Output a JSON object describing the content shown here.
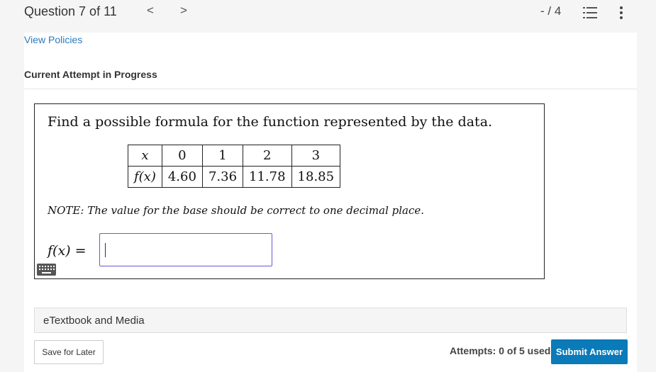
{
  "header": {
    "question_label": "Question 7 of 11",
    "prev_glyph": "<",
    "next_glyph": ">",
    "score": "- / 4",
    "list_icon": "question-list-icon",
    "more_icon": "more-options-icon"
  },
  "policies_link": "View Policies",
  "attempt_status": "Current Attempt in Progress",
  "question": {
    "prompt": "Find a possible formula for the function represented by the data.",
    "table": {
      "row_headers": [
        "x",
        "f(x)"
      ],
      "x_values": [
        "0",
        "1",
        "2",
        "3"
      ],
      "fx_values": [
        "4.60",
        "7.36",
        "11.78",
        "18.85"
      ]
    },
    "note": "NOTE: The value for the base should be correct to one decimal place.",
    "answer_label": "f(x) =",
    "answer_value": "",
    "keyboard_icon": "keyboard-icon"
  },
  "etextbook_label": "eTextbook and Media",
  "save_button": "Save for Later",
  "attempts_text": "Attempts: 0 of 5 used",
  "submit_button": "Submit Answer",
  "colors": {
    "link": "#2b7abc",
    "submit_bg": "#0a7ab8",
    "input_border": "#6a5ad5"
  }
}
